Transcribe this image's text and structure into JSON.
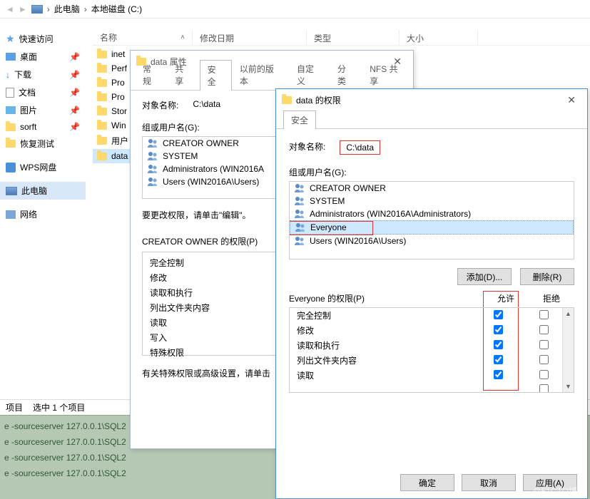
{
  "breadcrumb": {
    "pc": "此电脑",
    "drive": "本地磁盘 (C:)",
    "sep": "›"
  },
  "columns": {
    "name": "名称",
    "date": "修改日期",
    "type": "类型",
    "size": "大小"
  },
  "sidebar": {
    "quick": "快速访问",
    "desktop": "桌面",
    "downloads": "下载",
    "documents": "文档",
    "pictures": "图片",
    "sorft": "sorft",
    "recovery": "恢复测试",
    "wpsDisk": "WPS网盘",
    "thisPC": "此电脑",
    "network": "网络"
  },
  "files": [
    "inet",
    "Perf",
    "Pro",
    "Pro",
    "Stor",
    "Win",
    "用户",
    "data"
  ],
  "status": {
    "items": "项目",
    "selected": "选中 1 个项目"
  },
  "dlg1": {
    "title": "data 属性",
    "tabs": [
      "常规",
      "共享",
      "安全",
      "以前的版本",
      "自定义",
      "分类",
      "NFS 共享"
    ],
    "objLabel": "对象名称:",
    "objValue": "C:\\data",
    "groupLabel": "组或用户名(G):",
    "users": [
      "CREATOR OWNER",
      "SYSTEM",
      "Administrators (WIN2016A",
      "Users (WIN2016A\\Users)"
    ],
    "editHint": "要更改权限，请单击\"编辑\"。",
    "permHeader": "CREATOR OWNER 的权限(P)",
    "perms": [
      "完全控制",
      "修改",
      "读取和执行",
      "列出文件夹内容",
      "读取",
      "写入",
      "特殊权限"
    ],
    "specialHint": "有关特殊权限或高级设置，请单击"
  },
  "dlg2": {
    "title": "data 的权限",
    "tab": "安全",
    "objLabel": "对象名称:",
    "objValue": "C:\\data",
    "groupLabel": "组或用户名(G):",
    "users": [
      "CREATOR OWNER",
      "SYSTEM",
      "Administrators (WIN2016A\\Administrators)",
      "Everyone",
      "Users (WIN2016A\\Users)"
    ],
    "addBtn": "添加(D)...",
    "removeBtn": "删除(R)",
    "permHeader": "Everyone 的权限(P)",
    "allow": "允许",
    "deny": "拒绝",
    "perms": [
      "完全控制",
      "修改",
      "读取和执行",
      "列出文件夹内容",
      "读取"
    ],
    "ok": "确定",
    "cancel": "取消",
    "apply": "应用(A)"
  },
  "terminal": {
    "lines": [
      "e -sourceserver 127.0.0.1\\SQL2",
      "e -sourceserver 127.0.0.1\\SQL2",
      "e -sourceserver 127.0.0.1\\SQL2",
      "e -sourceserver 127.0.0.1\\SQL2"
    ]
  },
  "watermark": "@51CTO博客"
}
